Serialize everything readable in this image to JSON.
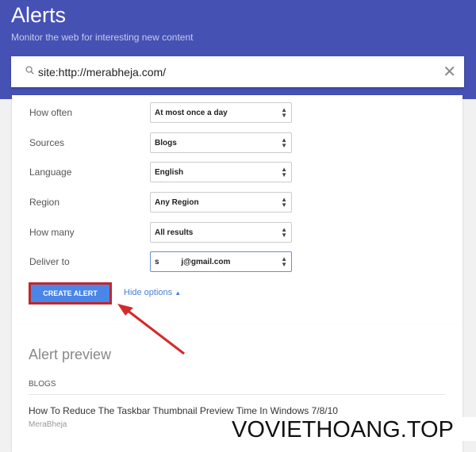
{
  "header": {
    "title": "Alerts",
    "subtitle": "Monitor the web for interesting new content"
  },
  "search": {
    "value": "site:http://merabheja.com/",
    "icon": "search-icon",
    "clear_icon": "close-icon"
  },
  "options": [
    {
      "label": "How often",
      "value": "At most once a day"
    },
    {
      "label": "Sources",
      "value": "Blogs"
    },
    {
      "label": "Language",
      "value": "English"
    },
    {
      "label": "Region",
      "value": "Any Region"
    },
    {
      "label": "How many",
      "value": "All results"
    },
    {
      "label": "Deliver to",
      "value": "s          j@gmail.com"
    }
  ],
  "create_label": "CREATE ALERT",
  "hide_options": "Hide options",
  "preview": {
    "title": "Alert preview",
    "section": "BLOGS",
    "item_title": "How To Reduce The Taskbar Thumbnail Preview Time In Windows 7/8/10",
    "item_source": "MeraBheja"
  },
  "watermark": "VOVIETHOANG.TOP",
  "colors": {
    "header": "#4551b3",
    "button": "#4a86e8",
    "highlight": "#c0272d"
  }
}
